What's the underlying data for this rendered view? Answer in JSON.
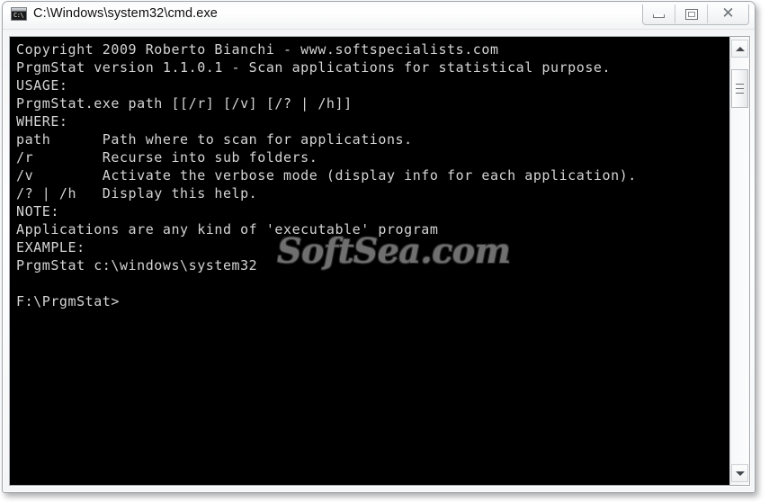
{
  "window": {
    "title": "C:\\Windows\\system32\\cmd.exe",
    "icon": "cmd-console-icon",
    "icon_glyph": "C:\\",
    "controls": {
      "minimize_label": "Minimize",
      "maximize_label": "Maximize",
      "close_label": "Close",
      "close_glyph": "✕"
    }
  },
  "console": {
    "background_color": "#000000",
    "text_color": "#d4d4d4",
    "lines": [
      "Copyright 2009 Roberto Bianchi - www.softspecialists.com",
      "PrgmStat version 1.1.0.1 - Scan applications for statistical purpose.",
      "USAGE:",
      "PrgmStat.exe path [[/r] [/v] [/? | /h]]",
      "WHERE:",
      "path      Path where to scan for applications.",
      "/r        Recurse into sub folders.",
      "/v        Activate the verbose mode (display info for each application).",
      "/? | /h   Display this help.",
      "NOTE:",
      "Applications are any kind of 'executable' program",
      "EXAMPLE:",
      "PrgmStat c:\\windows\\system32",
      "",
      "F:\\PrgmStat>"
    ],
    "text": "Copyright 2009 Roberto Bianchi - www.softspecialists.com\nPrgmStat version 1.1.0.1 - Scan applications for statistical purpose.\nUSAGE:\nPrgmStat.exe path [[/r] [/v] [/? | /h]]\nWHERE:\npath      Path where to scan for applications.\n/r        Recurse into sub folders.\n/v        Activate the verbose mode (display info for each application).\n/? | /h   Display this help.\nNOTE:\nApplications are any kind of 'executable' program\nEXAMPLE:\nPrgmStat c:\\windows\\system32\n\nF:\\PrgmStat>",
    "prompt": "F:\\PrgmStat>",
    "watermark": "SoftSea.com"
  },
  "scrollbar": {
    "up_arrow": "scroll-up-arrow",
    "down_arrow": "scroll-down-arrow",
    "thumb": "scroll-thumb"
  }
}
